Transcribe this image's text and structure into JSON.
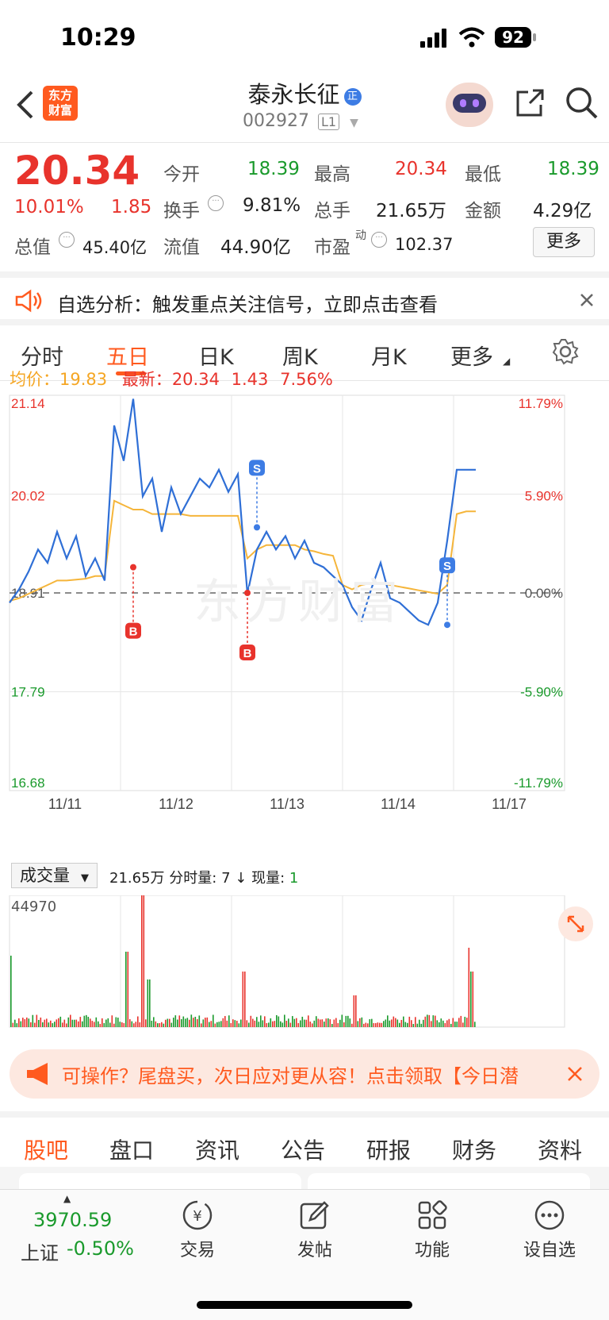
{
  "status_bar": {
    "time": "10:29",
    "battery": "92"
  },
  "header": {
    "logo_text_1": "东方",
    "logo_text_2": "财富",
    "stock_name": "泰永长征",
    "badge": "正",
    "stock_code": "002927",
    "level": "L1"
  },
  "quote": {
    "price": "20.34",
    "change_pct": "10.01%",
    "change": "1.85",
    "open_label": "今开",
    "open": "18.39",
    "high_label": "最高",
    "high": "20.34",
    "low_label": "最低",
    "low": "18.39",
    "turnover_label": "换手",
    "turnover": "9.81%",
    "volume_label": "总手",
    "volume": "21.65万",
    "amount_label": "金额",
    "amount": "4.29亿",
    "mcap_label": "总值",
    "mcap": "45.40亿",
    "float_label": "流值",
    "float_value": "44.90亿",
    "pe_label": "市盈",
    "pe_super": "动",
    "pe": "102.37",
    "more_button": "更多"
  },
  "notice": {
    "text": "自选分析：触发重点关注信号，立即点击查看"
  },
  "chart_tabs": {
    "items": [
      "分时",
      "五日",
      "日K",
      "周K",
      "月K",
      "更多"
    ],
    "active": "五日"
  },
  "chart_header": {
    "avg_label": "均价：",
    "avg": "19.83",
    "latest_label": "最新：",
    "latest": "20.34",
    "latest_change": "1.43",
    "latest_pct": "7.56%"
  },
  "chart_data": {
    "type": "line",
    "y_axis_left": [
      "21.14",
      "20.02",
      "18.91",
      "17.79",
      "16.68"
    ],
    "y_axis_right": [
      "11.79%",
      "5.90%",
      "0.00%",
      "-5.90%",
      "-11.79%"
    ],
    "x_labels": [
      "11/11",
      "11/12",
      "11/13",
      "11/14",
      "11/17"
    ],
    "ylim": [
      16.68,
      21.14
    ],
    "prev_close": 18.91,
    "series": [
      {
        "values": [
          18.8,
          18.95,
          19.15,
          19.4,
          19.25,
          19.6,
          19.3,
          19.55,
          19.1,
          19.3,
          19.05,
          20.8,
          20.4,
          21.1,
          20.0,
          20.2,
          19.6,
          20.1,
          19.8,
          20.0,
          20.2,
          20.1,
          20.3,
          20.05,
          20.25,
          18.9,
          19.4,
          19.6,
          19.4,
          19.55,
          19.3,
          19.5,
          19.25,
          19.2,
          19.1,
          19.0,
          18.75,
          18.6,
          18.95,
          19.25,
          18.85,
          18.8,
          18.7,
          18.6,
          18.55,
          18.8,
          19.5,
          20.3,
          20.3,
          20.3
        ]
      },
      {
        "values": [
          18.82,
          18.85,
          18.9,
          18.95,
          19.0,
          19.05,
          19.05,
          19.06,
          19.07,
          19.1,
          19.1,
          19.95,
          19.9,
          19.85,
          19.85,
          19.8,
          19.8,
          19.8,
          19.8,
          19.78,
          19.78,
          19.78,
          19.78,
          19.78,
          19.78,
          19.3,
          19.4,
          19.45,
          19.45,
          19.45,
          19.45,
          19.4,
          19.38,
          19.35,
          19.33,
          19.0,
          18.95,
          19.0,
          19.02,
          19.02,
          19.0,
          18.98,
          18.96,
          18.94,
          18.92,
          18.9,
          19.0,
          19.8,
          19.83,
          19.83
        ]
      }
    ],
    "markers": [
      "B",
      "B",
      "S",
      "S"
    ]
  },
  "volume": {
    "selector": "成交量",
    "total": "21.65万",
    "fs_label": "分时量:",
    "fs_value": "7",
    "fs_arrow": "↓",
    "now_label": "现量:",
    "now_value": "1",
    "max": "44970"
  },
  "banner": {
    "text": "可操作？尾盘买，次日应对更从容！点击领取【今日潜"
  },
  "bottom_tabs": {
    "items": [
      "股吧",
      "盘口",
      "资讯",
      "公告",
      "研报",
      "财务",
      "资料"
    ],
    "active": "股吧"
  },
  "bottom_bar": {
    "index_value": "3970.59",
    "index_name": "上证",
    "index_change": "-0.50%",
    "trade": "交易",
    "post": "发帖",
    "func": "功能",
    "watchlist": "设自选"
  },
  "colors": {
    "brand": "#ff5a1f",
    "up": "#e8332c",
    "down": "#1a9a2c",
    "line": "#2f6fd6",
    "avg": "#f5b53a"
  }
}
